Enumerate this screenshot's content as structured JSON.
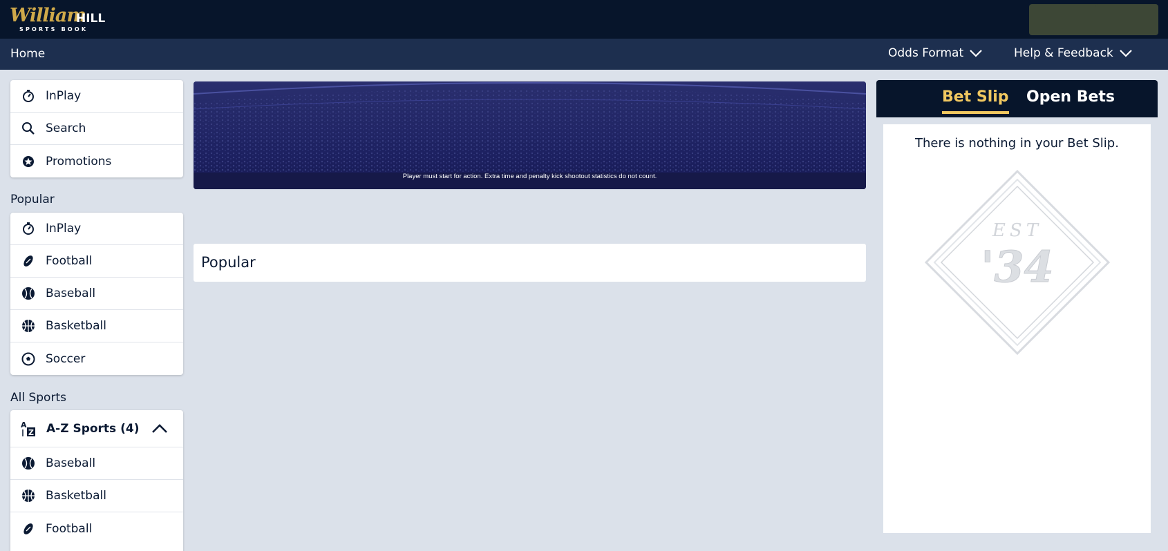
{
  "header": {
    "logo_script": "William",
    "logo_bold": "HILL",
    "logo_sub": "SPORTS BOOK"
  },
  "nav": {
    "home": "Home",
    "odds_format": "Odds Format",
    "help": "Help & Feedback"
  },
  "quick_links": [
    {
      "label": "InPlay",
      "icon": "stopwatch-icon"
    },
    {
      "label": "Search",
      "icon": "search-icon"
    },
    {
      "label": "Promotions",
      "icon": "star-badge-icon"
    }
  ],
  "popular": {
    "heading": "Popular",
    "items": [
      {
        "label": "InPlay",
        "icon": "stopwatch-icon"
      },
      {
        "label": "Football",
        "icon": "football-icon"
      },
      {
        "label": "Baseball",
        "icon": "baseball-icon"
      },
      {
        "label": "Basketball",
        "icon": "basketball-icon"
      },
      {
        "label": "Soccer",
        "icon": "soccer-ball-icon"
      }
    ]
  },
  "all_sports": {
    "heading": "All Sports",
    "az_label": "A-Z Sports (4)",
    "items": [
      {
        "label": "Baseball",
        "icon": "baseball-icon"
      },
      {
        "label": "Basketball",
        "icon": "basketball-icon"
      },
      {
        "label": "Football",
        "icon": "football-icon"
      }
    ]
  },
  "banner": {
    "note": "Player must start for action. Extra time and penalty kick shootout statistics do not count."
  },
  "main": {
    "popular_title": "Popular"
  },
  "betslip": {
    "tab_active": "Bet Slip",
    "tab_other": "Open Bets",
    "empty_message": "There is nothing in your Bet Slip.",
    "emblem_top": "EST",
    "emblem_year": "'34"
  },
  "colors": {
    "header_bg": "#07152b",
    "nav_bg": "#1d2f4f",
    "page_bg": "#dbe1ea",
    "accent_gold": "#f1c860",
    "logo_gold": "#cfa94a"
  }
}
